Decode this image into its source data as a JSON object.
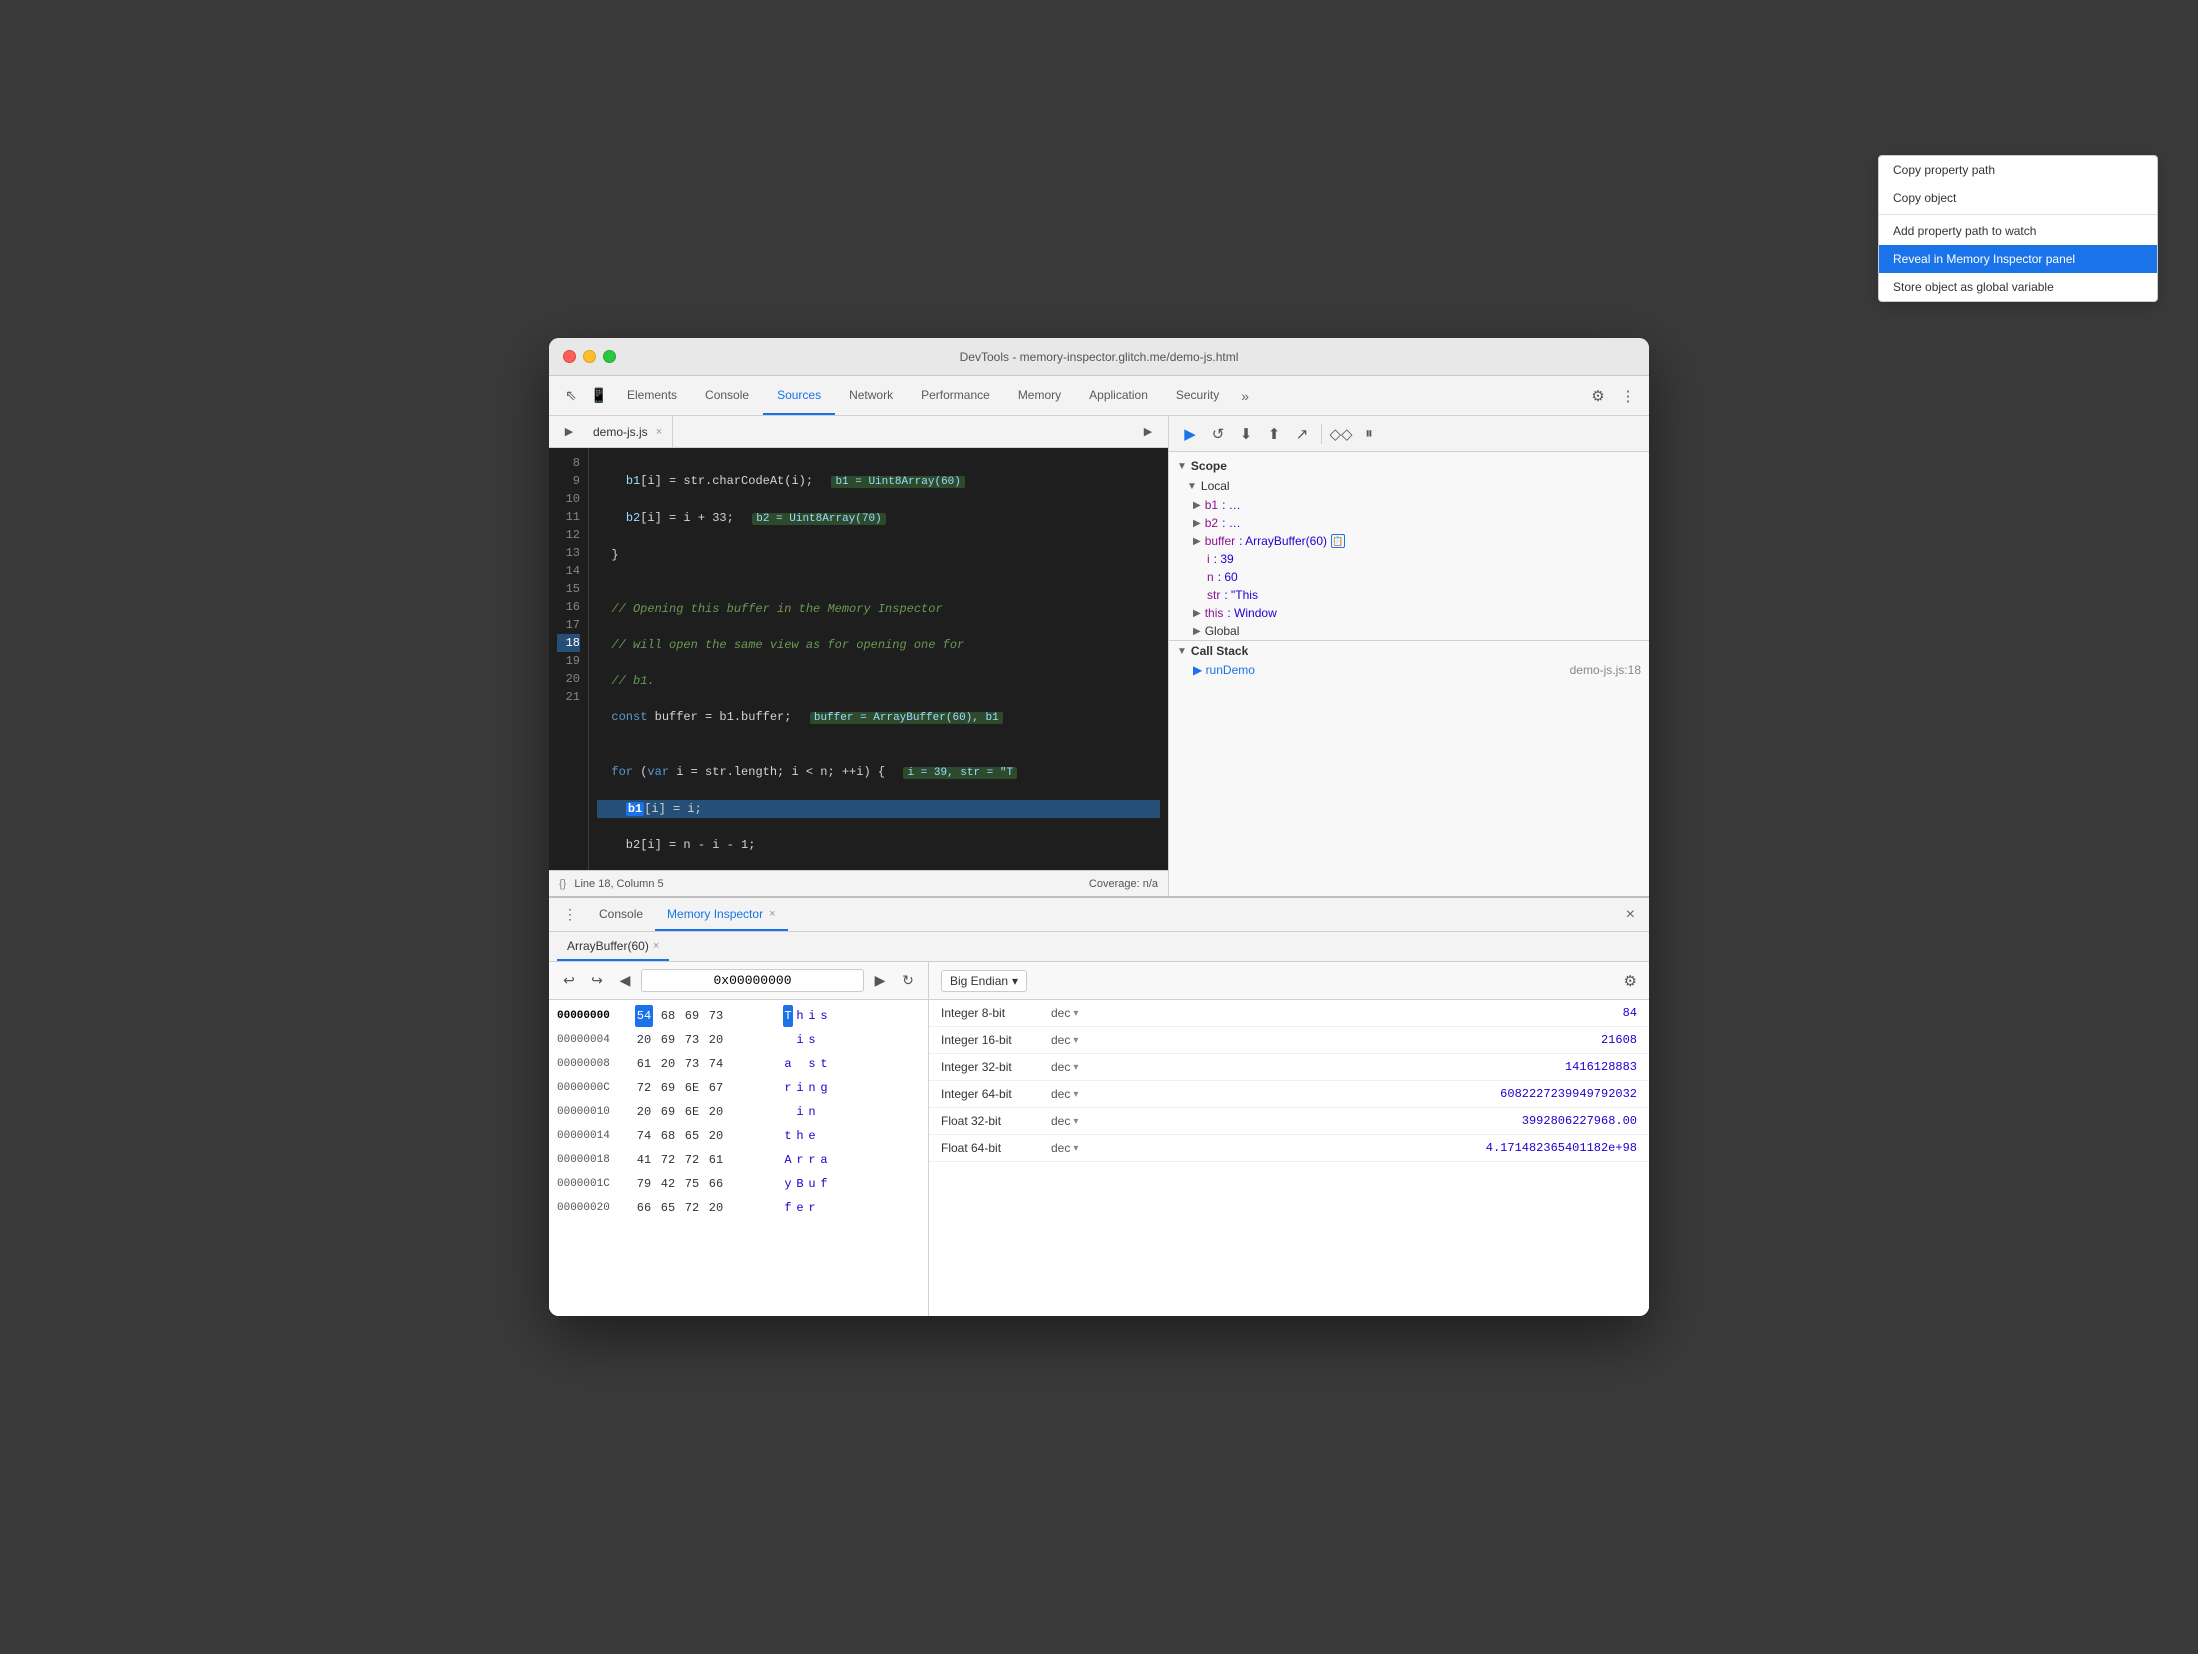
{
  "window": {
    "title": "DevTools - memory-inspector.glitch.me/demo-js.html"
  },
  "tabs": {
    "items": [
      "Elements",
      "Console",
      "Sources",
      "Network",
      "Performance",
      "Memory",
      "Application",
      "Security"
    ],
    "active": "Sources",
    "more": "»"
  },
  "file_tab": {
    "name": "demo-js.js",
    "close": "×"
  },
  "code": {
    "lines": [
      {
        "num": "8",
        "content": "    b1[i] = str.charCodeAt(i);",
        "inline": "b1 = Uint8Array(60)"
      },
      {
        "num": "9",
        "content": "    b2[i] = i + 33;",
        "inline": "b2 = Uint8Array(70)"
      },
      {
        "num": "10",
        "content": "  }"
      },
      {
        "num": "11",
        "content": ""
      },
      {
        "num": "12",
        "content": "  // Opening this buffer in the Memory Inspector"
      },
      {
        "num": "13",
        "content": "  // will open the same view as for opening one for"
      },
      {
        "num": "14",
        "content": "  // b1."
      },
      {
        "num": "15",
        "content": "  const buffer = b1.buffer;",
        "inline": "buffer = ArrayBuffer(60), b1"
      },
      {
        "num": "16",
        "content": ""
      },
      {
        "num": "17",
        "content": "  for (var i = str.length; i < n; ++i) {",
        "inline": "i = 39, str = \"T"
      },
      {
        "num": "18",
        "content": "    b1[i] = i;",
        "highlight": true
      },
      {
        "num": "19",
        "content": "    b2[i] = n - i - 1;"
      },
      {
        "num": "20",
        "content": "  }"
      },
      {
        "num": "21",
        "content": ""
      }
    ],
    "status": "Line 18, Column 5",
    "coverage": "Coverage: n/a"
  },
  "debug_toolbar": {
    "buttons": [
      "▶",
      "↺",
      "⬇",
      "⬆",
      "↗",
      "◇◇",
      "⏸"
    ]
  },
  "scope": {
    "section_label": "Scope",
    "local_label": "Local",
    "items": [
      {
        "key": "b1",
        "value": "…"
      },
      {
        "key": "b2",
        "value": "…"
      },
      {
        "key": "buffer",
        "value": "ArrayBuffer(60)",
        "memory_icon": true
      },
      {
        "key": "i",
        "value": "39"
      },
      {
        "key": "n",
        "value": "60"
      },
      {
        "key": "str",
        "value": "\"This"
      },
      {
        "key": "this",
        "value": "Window"
      }
    ],
    "global_label": "Global",
    "call_stack_label": "Call Stack",
    "call_stack_items": [
      {
        "name": "runDemo",
        "loc": "demo-js.js:18"
      }
    ]
  },
  "context_menu": {
    "items": [
      {
        "label": "Copy property path",
        "type": "normal"
      },
      {
        "label": "Copy object",
        "type": "normal"
      },
      {
        "label": "",
        "type": "separator"
      },
      {
        "label": "Add property path to watch",
        "type": "normal"
      },
      {
        "label": "Reveal in Memory Inspector panel",
        "type": "highlighted"
      },
      {
        "label": "Store object as global variable",
        "type": "normal"
      }
    ]
  },
  "bottom_panel": {
    "tabs": [
      "Console",
      "Memory Inspector"
    ],
    "active_tab": "Memory Inspector",
    "close_label": "×",
    "buffer_tab_label": "ArrayBuffer(60)",
    "buffer_tab_close": "×"
  },
  "hex_nav": {
    "back": "◀",
    "forward": "▶",
    "address": "0x00000000",
    "refresh": "↻"
  },
  "hex_rows": [
    {
      "addr": "00000000",
      "bold": true,
      "bytes": [
        "54",
        "68",
        "69",
        "73"
      ],
      "chars": [
        "T",
        "h",
        "i",
        "s"
      ],
      "selected_byte": "54",
      "selected_char": "T"
    },
    {
      "addr": "00000004",
      "bold": false,
      "bytes": [
        "20",
        "69",
        "73",
        "20"
      ],
      "chars": [
        "i",
        "s",
        "",
        ""
      ]
    },
    {
      "addr": "00000008",
      "bold": false,
      "bytes": [
        "61",
        "20",
        "73",
        "74"
      ],
      "chars": [
        "a",
        "s",
        "t",
        ""
      ]
    },
    {
      "addr": "0000000C",
      "bold": false,
      "bytes": [
        "72",
        "69",
        "6E",
        "67"
      ],
      "chars": [
        "r",
        "i",
        "n",
        "g"
      ]
    },
    {
      "addr": "00000010",
      "bold": false,
      "bytes": [
        "20",
        "69",
        "6E",
        "20"
      ],
      "chars": [
        "i",
        "n",
        "",
        ""
      ]
    },
    {
      "addr": "00000014",
      "bold": false,
      "bytes": [
        "74",
        "68",
        "65",
        "20"
      ],
      "chars": [
        "t",
        "h",
        "e",
        ""
      ]
    },
    {
      "addr": "00000018",
      "bold": false,
      "bytes": [
        "41",
        "72",
        "72",
        "61"
      ],
      "chars": [
        "A",
        "r",
        "r",
        "a"
      ]
    },
    {
      "addr": "0000001C",
      "bold": false,
      "bytes": [
        "79",
        "42",
        "75",
        "66"
      ],
      "chars": [
        "y",
        "B",
        "u",
        "f"
      ]
    },
    {
      "addr": "00000020",
      "bold": false,
      "bytes": [
        "66",
        "65",
        "72",
        "20"
      ],
      "chars": [
        "f",
        "e",
        "r",
        ""
      ]
    }
  ],
  "interpreter": {
    "endian_label": "Big Endian",
    "endian_arrow": "▾",
    "gear_icon": "⚙",
    "rows": [
      {
        "label": "Integer 8-bit",
        "format": "dec",
        "value": "84"
      },
      {
        "label": "Integer 16-bit",
        "format": "dec",
        "value": "21608"
      },
      {
        "label": "Integer 32-bit",
        "format": "dec",
        "value": "1416128883"
      },
      {
        "label": "Integer 64-bit",
        "format": "dec",
        "value": "6082227239949792032"
      },
      {
        "label": "Float 32-bit",
        "format": "dec",
        "value": "3992806227968.00"
      },
      {
        "label": "Float 64-bit",
        "format": "dec",
        "value": "4.171482365401182e+98"
      }
    ]
  }
}
